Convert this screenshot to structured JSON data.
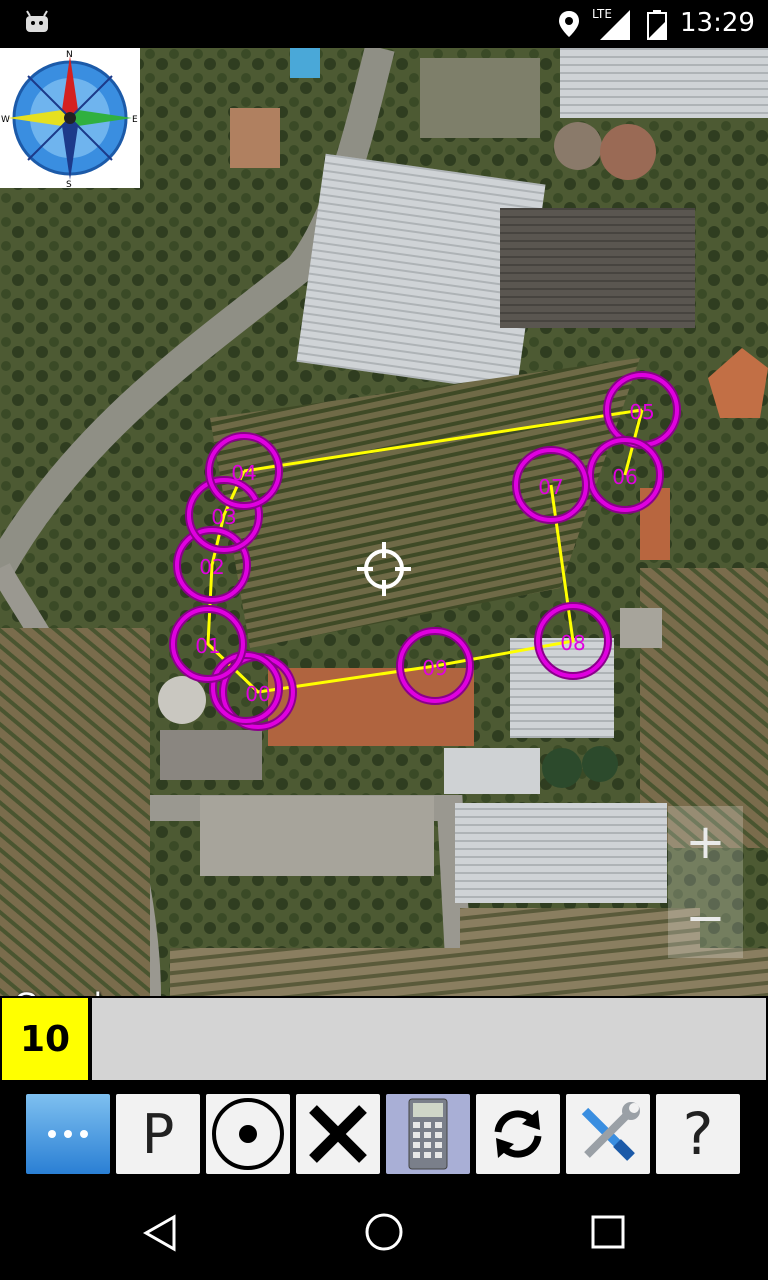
{
  "status_bar": {
    "time": "13:29",
    "network_label": "LTE",
    "icons": [
      "android-debug-icon",
      "location-icon",
      "signal-icon",
      "battery-icon"
    ]
  },
  "map": {
    "attribution": "Google",
    "zoom_in_label": "+",
    "zoom_out_label": "−",
    "waypoints": [
      "00",
      "01",
      "02",
      "03",
      "04",
      "05",
      "06",
      "07",
      "08",
      "09"
    ],
    "marker_color": "#e000e0",
    "polygon_color": "#ffff00"
  },
  "counter": {
    "value": "10",
    "color": "#ffff00"
  },
  "info_text": "",
  "toolbar": {
    "buttons": [
      {
        "name": "more",
        "label": "",
        "icon": "more-dots-icon"
      },
      {
        "name": "p",
        "label": "P",
        "icon": ""
      },
      {
        "name": "center",
        "label": "",
        "icon": "target-dot-icon"
      },
      {
        "name": "delete",
        "label": "",
        "icon": "x-icon"
      },
      {
        "name": "calculator",
        "label": "",
        "icon": "calculator-icon"
      },
      {
        "name": "refresh",
        "label": "",
        "icon": "refresh-icon"
      },
      {
        "name": "settings",
        "label": "",
        "icon": "tools-icon"
      },
      {
        "name": "help",
        "label": "?",
        "icon": ""
      }
    ]
  }
}
